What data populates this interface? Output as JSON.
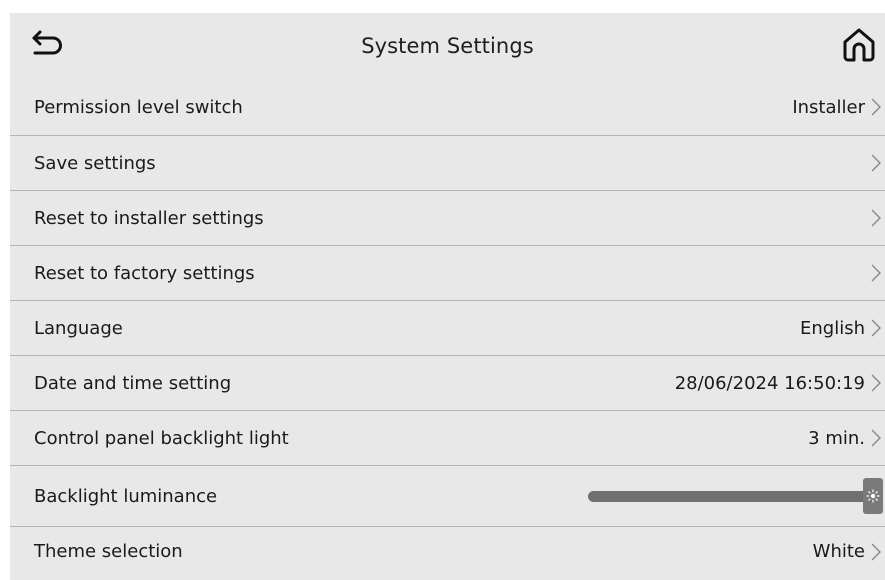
{
  "header": {
    "title": "System Settings"
  },
  "rows": [
    {
      "label": "Permission level switch",
      "value": "Installer"
    },
    {
      "label": "Save settings",
      "value": ""
    },
    {
      "label": "Reset to installer settings",
      "value": ""
    },
    {
      "label": "Reset to factory settings",
      "value": ""
    },
    {
      "label": "Language",
      "value": "English"
    },
    {
      "label": "Date and time setting",
      "value": "28/06/2024 16:50:19"
    },
    {
      "label": "Control panel backlight light",
      "value": "3 min."
    },
    {
      "label": "Backlight luminance",
      "slider_level": 1.0
    },
    {
      "label": "Theme selection",
      "value": "White"
    }
  ],
  "icons": {
    "back": "back-arrow-icon",
    "home": "home-icon",
    "chevron": "chevron-right-icon",
    "brightness": "sun-icon"
  },
  "colors": {
    "background": "#e8e8e8",
    "divider": "#b5b5b5",
    "slider": "#707070",
    "text": "#1a1a1a"
  }
}
